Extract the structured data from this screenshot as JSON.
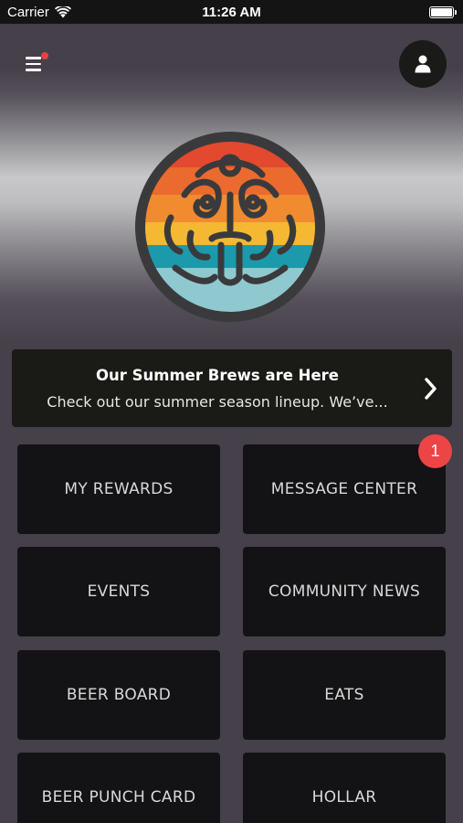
{
  "status_bar": {
    "carrier": "Carrier",
    "time": "11:26 AM"
  },
  "header": {
    "menu_icon": "hamburger-menu-icon",
    "profile_icon": "user-icon",
    "logo_icon": "tiki-mask-logo"
  },
  "banner": {
    "title": "Our Summer Brews are Here",
    "body": "Check out our summer season lineup. We’ve...",
    "arrow_icon": "chevron-right-icon"
  },
  "tiles": [
    {
      "label": "MY REWARDS"
    },
    {
      "label": "MESSAGE CENTER",
      "badge": "1"
    },
    {
      "label": "EVENTS"
    },
    {
      "label": "COMMUNITY NEWS"
    },
    {
      "label": "BEER BOARD"
    },
    {
      "label": "EATS"
    },
    {
      "label": "BEER PUNCH CARD"
    },
    {
      "label": "HOLLAR"
    }
  ],
  "colors": {
    "background": "#45404a",
    "tile": "#131315",
    "badge": "#ec4545"
  }
}
